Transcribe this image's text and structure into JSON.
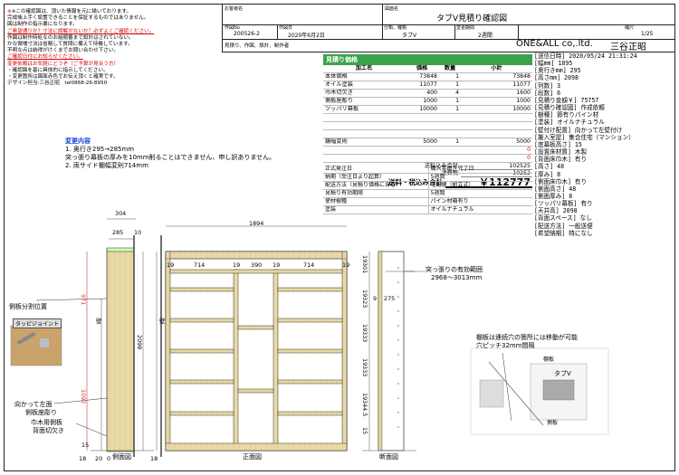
{
  "notes": {
    "lines": [
      {
        "text": "※この確認図は、頂いた情報を元に描いております。",
        "red": false,
        "star": true
      },
      {
        "text": "完成後上手く設置できることを保証するものではありません。",
        "red": false
      },
      {
        "text": "図は制作の指示書になります。",
        "red": false
      },
      {
        "text": "ご希望通りか？寸法に誤解がないか？必ずよくご確認ください。",
        "red": true
      },
      {
        "text": "作図は制作時処なのお組順番まで設計はされていない。",
        "red": false
      },
      {
        "text": "かな微増寸法は省略して質問に備えて待機しています。",
        "red": false
      },
      {
        "text": "不明な点は納得がけくまでお問い合わせ下さい。",
        "red": false
      },
      {
        "text": "ご確認日付にお知らせください。",
        "red": true
      },
      {
        "text": "変更依頼はお気軽にどうぞ（ご予算が見合う方）",
        "red": false
      },
      {
        "text": "・確認図を基に具体的に指示してください。",
        "red": false
      },
      {
        "text": "・変更箇所は図面赤色でお伝え頂くと確実です。",
        "red": false
      },
      {
        "text": "デザイン担当:三谷正昭　tel0868-26-8950",
        "red": false
      }
    ]
  },
  "header": {
    "customer_label": "お客様名",
    "drawing_name_label": "図面名",
    "drawing_name": "タブV見積り確認図",
    "doc_no_label": "作図No",
    "doc_no": "200526-2",
    "date_label": "作図日",
    "date": "2020年6月2日",
    "category_label": "分類、種類",
    "category": "タブV",
    "period_label": "変更期間",
    "period": "2週間",
    "sheet_label": "縮尺",
    "sheet": "1/25",
    "footer_left": "見積り、作図、設計、制作者",
    "company": "ONE&ALL co,.ltd.",
    "designer": "三谷正昭"
  },
  "estimate": {
    "title": "見積り価格",
    "columns": [
      "加工名",
      "価格",
      "数量",
      "小計"
    ],
    "rows": [
      [
        "本体価格",
        "73848",
        "1",
        "73848"
      ],
      [
        "オイル塗装",
        "11077",
        "1",
        "11077"
      ],
      [
        "巾木切欠き",
        "400",
        "4",
        "1600"
      ],
      [
        "側板座彫り",
        "1000",
        "1",
        "1000"
      ],
      [
        "ツッパリ幕板",
        "10000",
        "1",
        "10000"
      ],
      [
        "",
        "",
        "",
        ""
      ],
      [
        "",
        "",
        "",
        ""
      ],
      [
        "",
        "",
        "",
        ""
      ],
      [
        "鏡幅変則",
        "5000",
        "1",
        "5000"
      ],
      [
        "",
        "",
        "",
        "0"
      ],
      [
        "",
        "",
        "",
        "0"
      ]
    ],
    "subtotal_label": "送料込み合計",
    "subtotal": "102525",
    "tax_label": "消費税",
    "tax": "10252",
    "total_label": "送料・税込み合計",
    "total": "￥112777"
  },
  "spec": {
    "rows": [
      [
        "正式発注日",
        "購入手続き完了日"
      ],
      [
        "納期（受注日より起算）",
        "5週間"
      ],
      [
        "配送方法（見積り価格に含む）",
        "宅配便（組立式）"
      ],
      [
        "見積り有効期限",
        "5週間"
      ],
      [
        "使材樹種",
        "パイン材箱有り"
      ],
      [
        "塗装",
        "オイルナチュラル"
      ]
    ]
  },
  "info": {
    "lines": [
      "[送信日時] 2020/05/24 21:31:24",
      "[幅mm] 1895",
      "[奥行きmm] 295",
      "[高さmm] 2098",
      "[列数] 3",
      "[段数] 6",
      "[見積り金額￥] 75757",
      "[見積り確認図] 作成依頼",
      "[樹種] 節有りパイン材",
      "[塗装] オイルナチュラル",
      "[壁付け配置] 向かって左壁付け",
      "[搬入室屋] 集合住宅（マンション）",
      "[底幕板高さ] 15",
      "[設置床材質] 木製",
      "[背面床巾木] 有り",
      "[高さ] 48",
      "[厚み] 8",
      "[側面床巾木] 有り",
      "[側面高さ] 48",
      "[側面厚み] 8",
      "[ツッパリ幕板] 有り",
      "[天井高] 2098",
      "[背面スペース] なし",
      "[配送方法] 一般送便",
      "[希望納期] 特になし"
    ]
  },
  "change": {
    "title": "変更内容",
    "lines": [
      "1. 奥行き295→285mm",
      "突っ張り幕板の厚みを10mm削ることはできません、申し訳ありません。",
      "2. 両サイド棚幅変則714mm"
    ]
  },
  "drawing": {
    "dims_top": {
      "d304": "304",
      "d285": "285",
      "d10": "10",
      "d1894": "1894",
      "d19a": "19",
      "d714a": "714",
      "d19b": "19",
      "d390": "390",
      "d19c": "19",
      "d714b": "714",
      "d19d": "19"
    },
    "side_dims": {
      "d971": "971",
      "d2098": "2098",
      "d1092": "1092",
      "d15": "15"
    },
    "label_wall1": "壁",
    "label_wall2": "壁",
    "labels": {
      "side_board": "側板分割位置",
      "tappy_joint": "タッピジョイント",
      "left_side": "向かって左面",
      "left_side2": "側板座彫り",
      "skirting": "巾木用側板",
      "skirting2": "背面切欠き",
      "side_view": "側面図",
      "front_view": "正面図",
      "section_view": "断面図",
      "ceiling_range": "突っ張りの有効範囲",
      "ceiling_range2": "2968〜3013mm",
      "dowel": "棚板は連続穴の箇所には移動が可能",
      "dowel2": "穴ピッチ32mm間隔",
      "tabv": "タブV",
      "sideboard": "側板",
      "shelf_pin": "棚板",
      "d275": "275",
      "d9": "9",
      "d18": "18",
      "d20": "20",
      "d0": "0",
      "d18b": "18"
    },
    "right_dims": [
      "19",
      "301",
      "19",
      "323",
      "19",
      "333",
      "19",
      "333",
      "19",
      "344.5",
      "15"
    ]
  }
}
